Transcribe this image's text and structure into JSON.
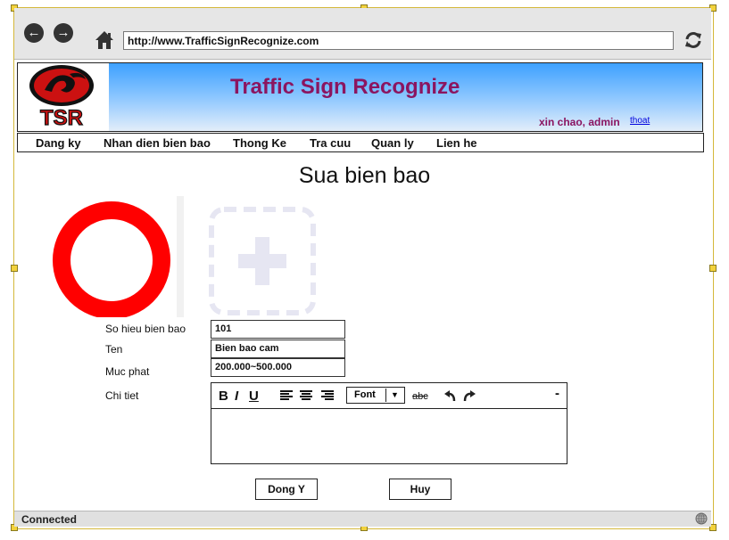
{
  "browser": {
    "url": "http://www.TrafficSignRecognize.com",
    "status": "Connected"
  },
  "site": {
    "logo_text": "TSR",
    "title": "Traffic Sign Recognize",
    "greeting": "xin chao, admin",
    "logout": "thoat"
  },
  "menu": {
    "items": [
      {
        "label": "Dang ky"
      },
      {
        "label": "Nhan dien bien bao"
      },
      {
        "label": "Thong Ke"
      },
      {
        "label": "Tra cuu"
      },
      {
        "label": "Quan ly"
      },
      {
        "label": "Lien he"
      }
    ]
  },
  "page": {
    "heading": "Sua bien bao"
  },
  "form": {
    "code_label": "So hieu bien bao",
    "code_value": "101",
    "name_label": "Ten",
    "name_value": "Bien bao cam",
    "fine_label": "Muc phat",
    "fine_value": "200.000~500.000",
    "detail_label": "Chi tiet"
  },
  "editor": {
    "bold": "B",
    "italic": "I",
    "underline": "U",
    "font_label": "Font",
    "strike": "abc",
    "minimize": "-"
  },
  "buttons": {
    "ok": "Dong Y",
    "cancel": "Huy"
  },
  "colors": {
    "title": "#8b1560",
    "sign_red": "#ff0000",
    "banner_blue": "#3da0ff"
  }
}
